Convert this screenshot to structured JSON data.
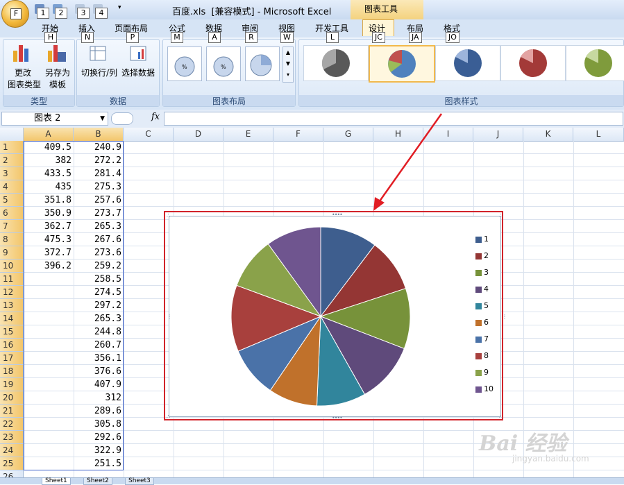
{
  "window": {
    "title": "百度.xls  [兼容模式] - Microsoft Excel",
    "context_tab_group": "图表工具"
  },
  "keytips": {
    "office": "F",
    "qat": [
      "1",
      "2",
      "3",
      "4"
    ],
    "tabs": [
      "H",
      "N",
      "P",
      "M",
      "A",
      "R",
      "W",
      "L",
      "JC",
      "JA",
      "JO"
    ]
  },
  "tabs": [
    {
      "label": "开始"
    },
    {
      "label": "插入"
    },
    {
      "label": "页面布局"
    },
    {
      "label": "公式"
    },
    {
      "label": "数据"
    },
    {
      "label": "审阅"
    },
    {
      "label": "视图"
    },
    {
      "label": "开发工具"
    },
    {
      "label": "设计",
      "selected": true
    },
    {
      "label": "布局"
    },
    {
      "label": "格式"
    }
  ],
  "ribbon": {
    "groups": {
      "type": {
        "label": "类型",
        "change_type": "更改\n图表类型",
        "save_template": "另存为\n模板"
      },
      "data": {
        "label": "数据",
        "switch_row_col": "切换行/列",
        "select_data": "选择数据"
      },
      "layouts": {
        "label": "图表布局"
      },
      "styles": {
        "label": "图表样式"
      }
    }
  },
  "formula_bar": {
    "name_box": "图表 2",
    "fx_label": "fx",
    "formula": ""
  },
  "sheet": {
    "columns": [
      "A",
      "B",
      "C",
      "D",
      "E",
      "F",
      "G",
      "H",
      "I",
      "J",
      "K",
      "L"
    ],
    "rows": [
      "1",
      "2",
      "3",
      "4",
      "5",
      "6",
      "7",
      "8",
      "9",
      "10",
      "11",
      "12",
      "13",
      "14",
      "15",
      "16",
      "17",
      "18",
      "19",
      "20",
      "21",
      "22",
      "23",
      "24",
      "25",
      "26"
    ],
    "col_a": [
      "409.5",
      "382",
      "433.5",
      "435",
      "351.8",
      "350.9",
      "362.7",
      "475.3",
      "372.7",
      "396.2"
    ],
    "col_b": [
      "240.9",
      "272.2",
      "281.4",
      "275.3",
      "257.6",
      "273.7",
      "265.3",
      "267.6",
      "273.6",
      "259.2",
      "258.5",
      "274.5",
      "297.2",
      "265.3",
      "244.8",
      "260.7",
      "356.1",
      "376.6",
      "407.9",
      "312",
      "289.6",
      "305.8",
      "292.6",
      "322.9",
      "251.5"
    ],
    "tabs": [
      "Sheet1",
      "Sheet2",
      "Sheet3"
    ]
  },
  "chart_data": {
    "type": "pie",
    "categories": [
      "1",
      "2",
      "3",
      "4",
      "5",
      "6",
      "7",
      "8",
      "9",
      "10"
    ],
    "values": [
      409.5,
      382,
      433.5,
      435,
      351.8,
      350.9,
      362.7,
      475.3,
      372.7,
      396.2
    ],
    "colors": [
      "#3e5e8e",
      "#943634",
      "#77923a",
      "#5f4a7b",
      "#31859c",
      "#c0712b",
      "#4a72a8",
      "#a8403d",
      "#8aa24a",
      "#6f558f"
    ],
    "legend": "right"
  },
  "watermark": {
    "brand": "Bai 经验",
    "url": "jingyan.baidu.com"
  }
}
